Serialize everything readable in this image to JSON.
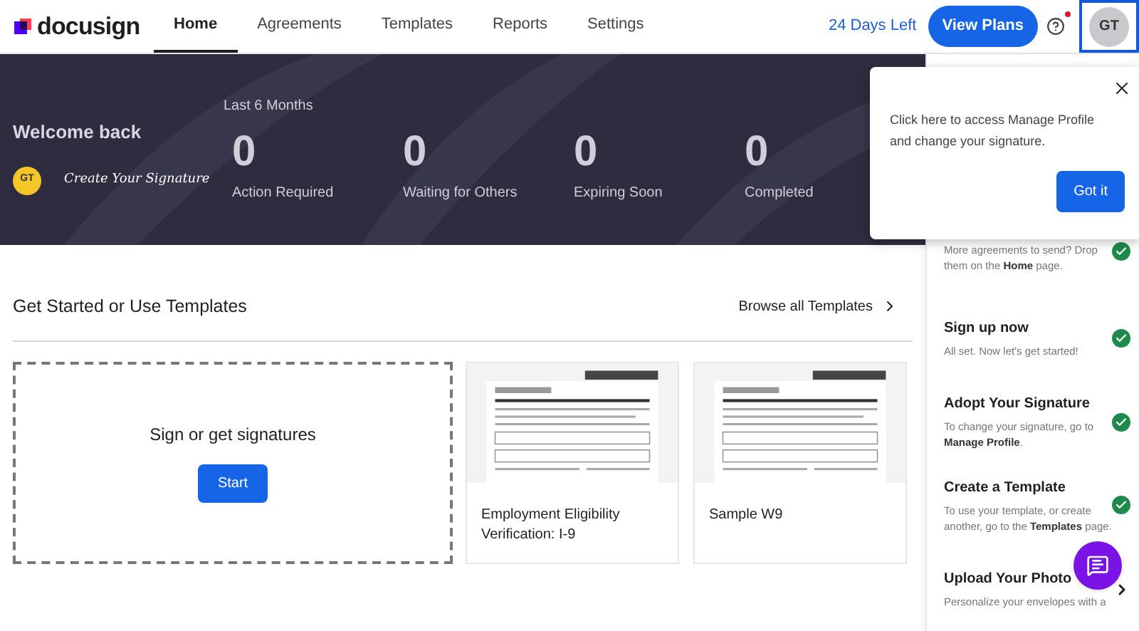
{
  "logo": {
    "text": "docusign"
  },
  "nav": [
    {
      "label": "Home",
      "selected": true
    },
    {
      "label": "Agreements",
      "selected": false
    },
    {
      "label": "Templates",
      "selected": false
    },
    {
      "label": "Reports",
      "selected": false
    },
    {
      "label": "Settings",
      "selected": false
    }
  ],
  "trial": "24 Days Left",
  "plans_button": "View Plans",
  "help": {
    "notification": true
  },
  "avatar": {
    "initials": "GT",
    "highlighted": true
  },
  "hero": {
    "greeting": "Welcome back",
    "initials": "GT",
    "signature": "Create Your Signature",
    "period": "Last 6 Months",
    "stats": [
      {
        "value": "0",
        "label": "Action Required"
      },
      {
        "value": "0",
        "label": "Waiting for Others"
      },
      {
        "value": "0",
        "label": "Expiring Soon"
      },
      {
        "value": "0",
        "label": "Completed"
      }
    ]
  },
  "templates": {
    "title": "Get Started or Use Templates",
    "browse": "Browse all Templates",
    "start_card": {
      "title": "Sign or get signatures",
      "button": "Start"
    },
    "cards": [
      {
        "kind": "picture",
        "name": "Employment Eligibility Verification: I-9"
      },
      {
        "kind": "picture",
        "name": "Sample W9"
      }
    ]
  },
  "popup": {
    "text": "Click here to access Manage Profile and change your signature.",
    "button": "Got it"
  },
  "steps": [
    {
      "description": "More agreements to send? Drop them on the **Home** page.",
      "done": true
    },
    {
      "title": "Sign up now",
      "description": "All set. Now let's get started!",
      "done": true
    },
    {
      "title": "Adopt Your Signature",
      "description": "To change your signature, go to **Manage Profile**.",
      "done": true
    },
    {
      "title": "Create a Template",
      "description": "To use your template, or create another, go to the **Templates** page.",
      "done": true
    },
    {
      "title": "Upload Your Photo",
      "description": "Personalize your envelopes with a",
      "done": false
    }
  ]
}
